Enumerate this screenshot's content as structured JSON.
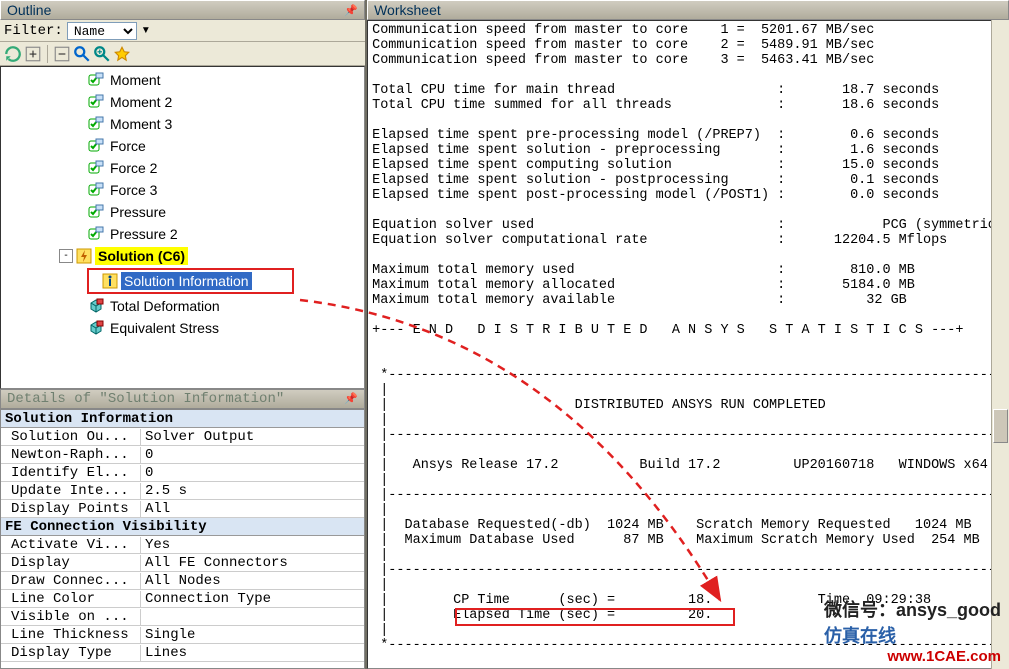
{
  "outline": {
    "title": "Outline",
    "filter_label": "Filter:",
    "filter_value": "Name",
    "tree": [
      {
        "level": 2,
        "icon": "check",
        "label": "Moment"
      },
      {
        "level": 2,
        "icon": "check",
        "label": "Moment 2"
      },
      {
        "level": 2,
        "icon": "check",
        "label": "Moment 3"
      },
      {
        "level": 2,
        "icon": "check",
        "label": "Force"
      },
      {
        "level": 2,
        "icon": "check",
        "label": "Force 2"
      },
      {
        "level": 2,
        "icon": "check",
        "label": "Force 3"
      },
      {
        "level": 2,
        "icon": "check",
        "label": "Pressure"
      },
      {
        "level": 2,
        "icon": "check",
        "label": "Pressure 2"
      },
      {
        "level": 1,
        "toggle": "-",
        "icon": "bolt",
        "label": "Solution (C6)",
        "highlight": true
      },
      {
        "level": 2,
        "icon": "info",
        "label": "Solution Information",
        "selected": true,
        "redbox": true
      },
      {
        "level": 2,
        "icon": "cube",
        "label": "Total Deformation"
      },
      {
        "level": 2,
        "icon": "cube",
        "label": "Equivalent Stress"
      }
    ]
  },
  "details": {
    "title": "Details of \"Solution Information\"",
    "rows": [
      {
        "cat": "Solution Information"
      },
      {
        "k": "Solution Ou...",
        "v": "Solver Output"
      },
      {
        "k": "Newton-Raph...",
        "v": "0"
      },
      {
        "k": "Identify El...",
        "v": "0"
      },
      {
        "k": "Update Inte...",
        "v": "2.5 s"
      },
      {
        "k": "Display Points",
        "v": "All"
      },
      {
        "cat": "FE Connection Visibility"
      },
      {
        "k": "Activate Vi...",
        "v": "Yes"
      },
      {
        "k": "Display",
        "v": "All FE Connectors"
      },
      {
        "k": "Draw Connec...",
        "v": "All Nodes"
      },
      {
        "k": "Line Color",
        "v": "Connection Type"
      },
      {
        "k": "Visible on ...",
        "v": ""
      },
      {
        "k": "Line Thickness",
        "v": "Single"
      },
      {
        "k": "Display Type",
        "v": "Lines"
      }
    ]
  },
  "worksheet": {
    "title": "Worksheet",
    "lines": [
      "Communication speed from master to core    1 =  5201.67 MB/sec",
      "Communication speed from master to core    2 =  5489.91 MB/sec",
      "Communication speed from master to core    3 =  5463.41 MB/sec",
      "",
      "Total CPU time for main thread                    :       18.7 seconds",
      "Total CPU time summed for all threads             :       18.6 seconds",
      "",
      "Elapsed time spent pre-processing model (/PREP7)  :        0.6 seconds",
      "Elapsed time spent solution - preprocessing       :        1.6 seconds",
      "Elapsed time spent computing solution             :       15.0 seconds",
      "Elapsed time spent solution - postprocessing      :        0.1 seconds",
      "Elapsed time spent post-processing model (/POST1) :        0.0 seconds",
      "",
      "Equation solver used                              :            PCG (symmetric)",
      "Equation solver computational rate                :      12204.5 Mflops",
      "",
      "Maximum total memory used                         :        810.0 MB",
      "Maximum total memory allocated                    :       5184.0 MB",
      "Maximum total memory available                    :          32 GB",
      "",
      "+--- E N D   D I S T R I B U T E D   A N S Y S   S T A T I S T I C S ---+",
      "",
      "",
      " *---------------------------------------------------------------------------*",
      " |                                                                           |",
      " |                       DISTRIBUTED ANSYS RUN COMPLETED                     |",
      " |                                                                           |",
      " |---------------------------------------------------------------------------|",
      " |                                                                           |",
      " |   Ansys Release 17.2          Build 17.2         UP20160718   WINDOWS x64 |",
      " |                                                                           |",
      " |---------------------------------------------------------------------------|",
      " |                                                                           |",
      " |  Database Requested(-db)  1024 MB    Scratch Memory Requested   1024 MB   |",
      " |  Maximum Database Used      87 MB    Maximum Scratch Memory Used  254 MB  |",
      " |                                                                           |",
      " |---------------------------------------------------------------------------|",
      " |                                                                           |",
      " |        CP Time      (sec) =         18.             Time  09:29:38        |",
      " |        Elapsed Time (sec) =         20.                                   |",
      " |                                                                           |",
      " *---------------------------------------------------------------------------*"
    ]
  },
  "watermark": {
    "wechat_label": "微信号：",
    "wechat_id": "ansys_good",
    "site_cn": "仿真在线",
    "site_url": "www.1CAE.com"
  }
}
